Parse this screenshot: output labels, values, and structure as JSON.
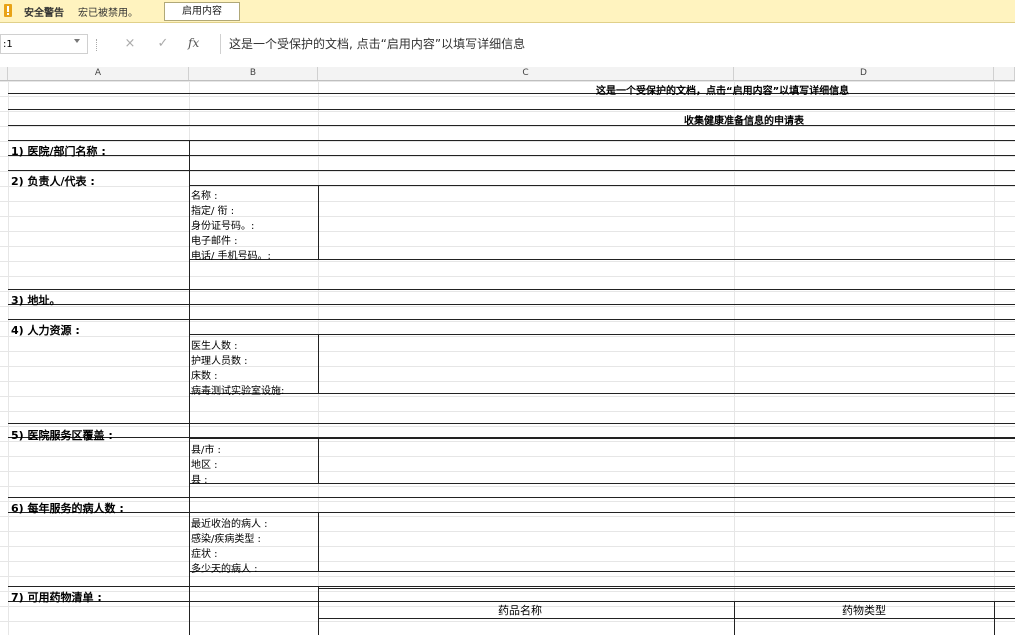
{
  "security_bar": {
    "title": "安全警告",
    "message": "宏已被禁用。",
    "enable_button": "启用内容"
  },
  "formula_bar": {
    "name_box": ":1",
    "cancel_icon": "×",
    "enter_icon": "✓",
    "fx_label": "fx",
    "formula": "这是一个受保护的文档, 点击“启用内容”以填写详细信息"
  },
  "columns": [
    "A",
    "B",
    "C",
    "D"
  ],
  "sheet": {
    "notice": "这是一个受保护的文档，点击“启用内容”以填写详细信息",
    "form_title": "收集健康准备信息的申请表",
    "sections": [
      {
        "label": "1)   医院/部门名称   :",
        "fields": []
      },
      {
        "label": "2)   负责人/代表   :",
        "fields": [
          "名称 :",
          "指定/ 衔 :",
          "身份证号码。:",
          "电子邮件 :",
          "电话/ 手机号码。:"
        ]
      },
      {
        "label": "3)   地址。",
        "fields": []
      },
      {
        "label": "4)   人力资源   :",
        "fields": [
          "医生人数 :",
          "护理人员数 :",
          "床数 :",
          "病毒测试实验室设施:"
        ]
      },
      {
        "label": "5)   医院服务区覆盖   :",
        "fields": [
          "县/市 :",
          "地区 :",
          "县 :"
        ]
      },
      {
        "label": "6)   每年服务的病人数   :",
        "fields": [
          "最近收治的病人 :",
          "感染/疾病类型 :",
          "症状 :",
          "多少天的病人 :"
        ]
      },
      {
        "label": "7)   可用药物清单   :",
        "fields": []
      }
    ],
    "table_headers": [
      "药品名称",
      "药物类型"
    ]
  }
}
